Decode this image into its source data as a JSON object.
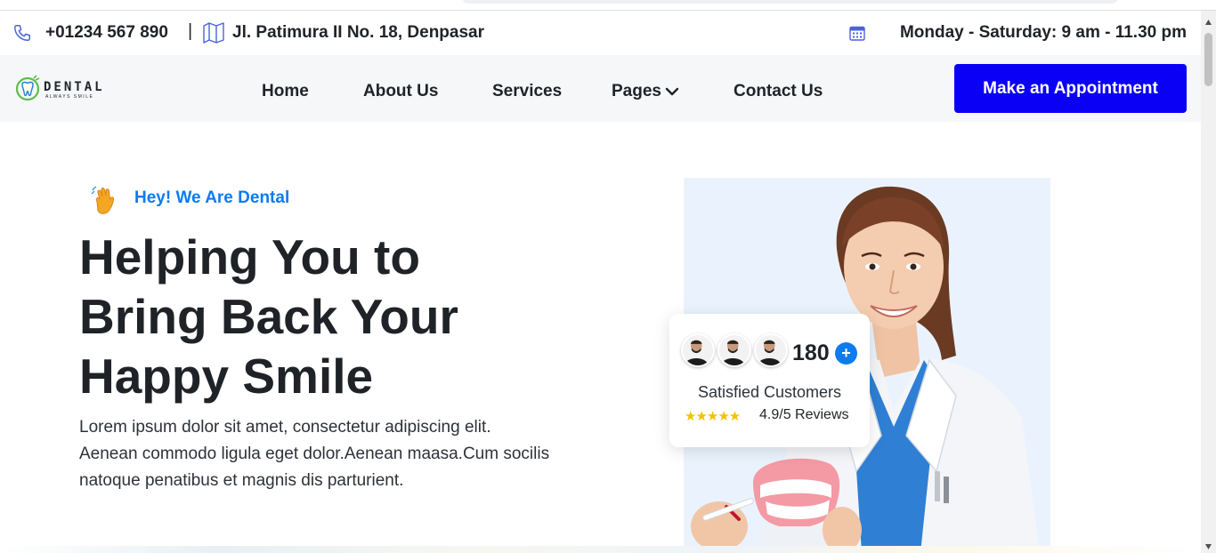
{
  "topbar": {
    "phone": "+01234 567 890",
    "separator": "|",
    "address": "Jl. Patimura II No. 18, Denpasar",
    "hours": "Monday - Saturday: 9 am - 11.30 pm",
    "icon_color": "#4a63d9"
  },
  "logo": {
    "word": "DENTAL",
    "tagline": "ALWAYS SMILE",
    "accent": "#5bbf4a"
  },
  "nav": {
    "items": [
      "Home",
      "About Us",
      "Services",
      "Pages",
      "Contact Us"
    ],
    "cta": "Make an Appointment",
    "cta_color": "#0a00f5"
  },
  "hero": {
    "eyebrow": "Hey! We Are Dental",
    "eyebrow_color": "#0a7cf0",
    "title_lines": [
      "Helping You to",
      "Bring Back Your",
      "Happy Smile"
    ],
    "text_lines": [
      "Lorem ipsum dolor sit amet, consectetur adipiscing elit.",
      "Aenean commodo ligula eget dolor.Aenean maasa.Cum socilis",
      "natoque penatibus et magnis dis parturient."
    ]
  },
  "review_card": {
    "count": "180",
    "plus": "+",
    "label": "Satisfied Customers",
    "stars": "★★★★★",
    "rating_text": "4.9/5 Reviews",
    "rating_value": 4.9,
    "rating_max": 5
  }
}
